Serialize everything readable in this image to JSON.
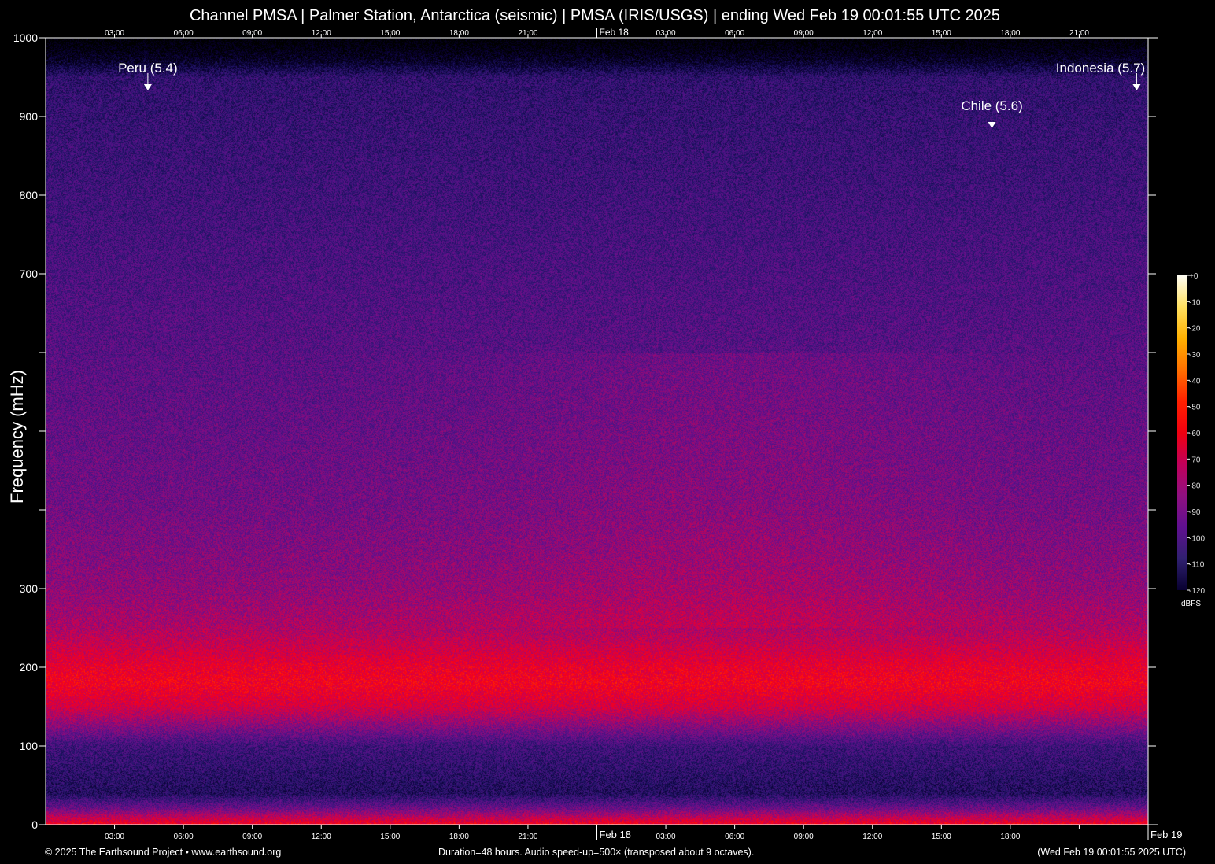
{
  "header": {
    "title": "Channel PMSA | Palmer Station, Antarctica (seismic) | PMSA (IRIS/USGS) | ending Wed Feb 19 00:01:55 UTC 2025"
  },
  "footer": {
    "copyright": "© 2025 The Earthsound Project • www.earthsound.org",
    "duration": "Duration=48 hours. Audio speed-up=500× (transposed about 9 octaves).",
    "end_time": "(Wed Feb 19 00:01:55 2025 UTC)"
  },
  "chart_data": {
    "type": "heatmap",
    "title": "Channel PMSA | Palmer Station, Antarctica (seismic) | PMSA (IRIS/USGS) | ending Wed Feb 19 00:01:55 UTC 2025",
    "ylabel": "Frequency (mHz)",
    "ylim": [
      0,
      1000
    ],
    "yticks": [
      0,
      100,
      200,
      300,
      400,
      500,
      600,
      700,
      800,
      900,
      1000
    ],
    "ytick_labels": [
      "0",
      "100",
      "200",
      "300",
      "",
      "",
      "",
      "700",
      "800",
      "900",
      "1000"
    ],
    "xlim_hours": [
      0,
      48
    ],
    "bottom_xtick_labels": [
      "03:00",
      "06:00",
      "09:00",
      "12:00",
      "15:00",
      "18:00",
      "21:00",
      "Feb 18",
      "03:00",
      "06:00",
      "09:00",
      "12:00",
      "15:00",
      "18:00",
      "",
      "Feb 19"
    ],
    "top_xtick_labels": [
      "03:00",
      "06:00",
      "09:00",
      "12:00",
      "15:00",
      "18:00",
      "21:00",
      "Feb 18",
      "03:00",
      "06:00",
      "09:00",
      "12:00",
      "15:00",
      "18:00",
      "21:00"
    ],
    "colorbar": {
      "label": "dBFS",
      "range": [
        -120,
        0
      ],
      "tick_labels": [
        "+0",
        "-10",
        "-20",
        "-30",
        "-40",
        "-50",
        "-60",
        "-70",
        "-80",
        "-90",
        "-100",
        "-110",
        "-120"
      ]
    },
    "intensity_profile": {
      "freq_mHz": [
        0,
        20,
        40,
        60,
        100,
        150,
        180,
        200,
        250,
        300,
        400,
        600,
        800,
        950,
        970,
        1000
      ],
      "dBFS": [
        -50,
        -80,
        -100,
        -98,
        -92,
        -60,
        -52,
        -55,
        -68,
        -74,
        -80,
        -86,
        -92,
        -96,
        -112,
        -125
      ]
    },
    "events": [
      {
        "label": "Peru (5.4)",
        "hour": 4.45,
        "freq_mHz": 935
      },
      {
        "label": "Chile (5.6)",
        "hour": 41.2,
        "freq_mHz": 887
      },
      {
        "label": "Indonesia (5.7)",
        "hour": 47.5,
        "freq_mHz": 935
      }
    ]
  }
}
